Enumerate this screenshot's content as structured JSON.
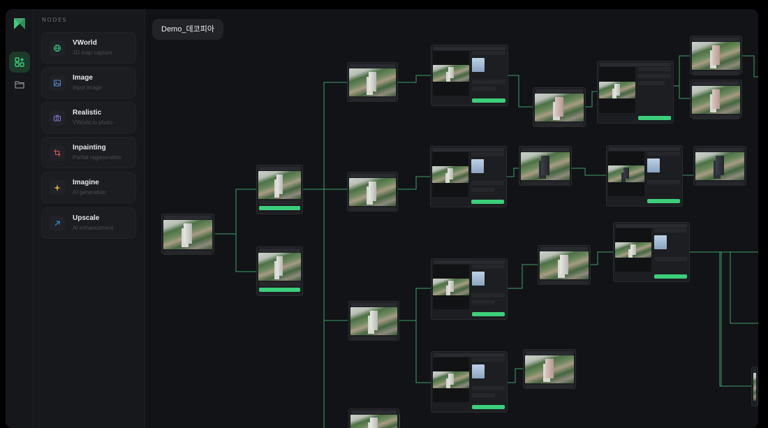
{
  "palette": {
    "title": "NODES",
    "items": [
      {
        "name": "VWorld",
        "subtitle": "3D map capture",
        "icon": "globe-icon",
        "color": "#3ccf7a"
      },
      {
        "name": "Image",
        "subtitle": "Input image",
        "icon": "image-icon",
        "color": "#5b8bd9"
      },
      {
        "name": "Realistic",
        "subtitle": "VWorld to photo",
        "icon": "camera-icon",
        "color": "#8a78d6"
      },
      {
        "name": "Inpainting",
        "subtitle": "Partial regeneration",
        "icon": "crop-icon",
        "color": "#e0544e"
      },
      {
        "name": "Imagine",
        "subtitle": "AI generation",
        "icon": "sparkle-icon",
        "color": "#d6b13c"
      },
      {
        "name": "Upscale",
        "subtitle": "AI enhancement",
        "icon": "arrow-up-right-icon",
        "color": "#3a9bd9"
      }
    ]
  },
  "canvas": {
    "tab_title": "Demo_데코피아"
  },
  "colors": {
    "accent": "#3ccf7a",
    "wire": "#3f9f6a",
    "background": "#121316"
  }
}
